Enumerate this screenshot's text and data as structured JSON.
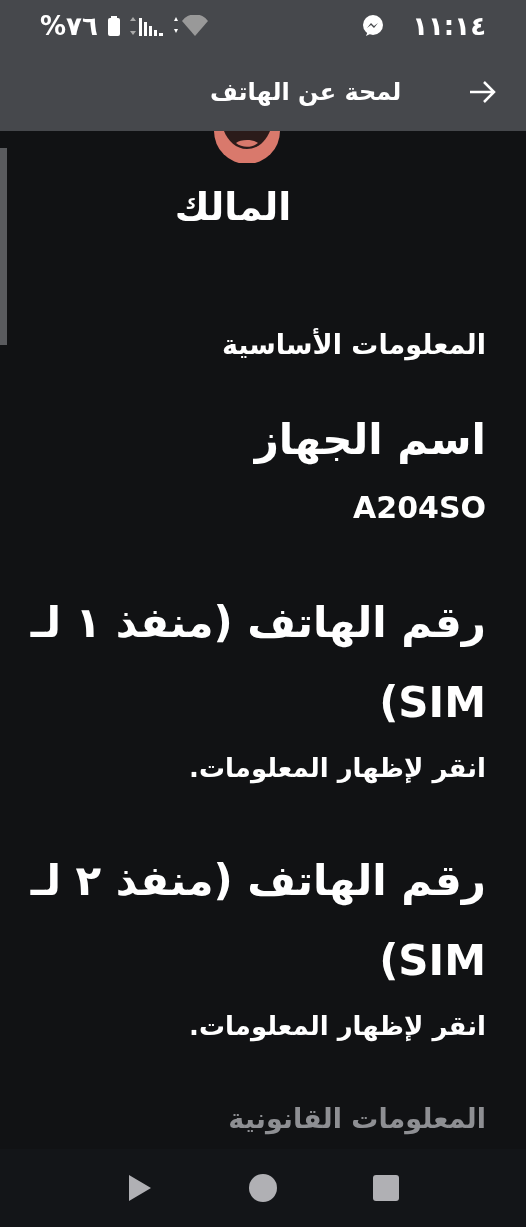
{
  "status_bar": {
    "time": "١١:١٤",
    "battery": "%٧٦"
  },
  "app_bar": {
    "title": "لمحة عن الهاتف"
  },
  "owner": {
    "name": "المالك"
  },
  "items": [
    {
      "kind": "header",
      "text": "المعلومات الأساسية",
      "faded": false
    },
    {
      "kind": "value_item",
      "title": "اسم الجهاز",
      "summary": "A204SO"
    },
    {
      "kind": "tap_item",
      "title": "رقم الهاتف (منفذ ١ لـ SIM)",
      "summary": "انقر لإظهار المعلومات."
    },
    {
      "kind": "tap_item",
      "title": "رقم الهاتف (منفذ ٢ لـ SIM)",
      "summary": "انقر لإظهار المعلومات."
    },
    {
      "kind": "header",
      "text": "المعلومات القانونية",
      "faded": true
    }
  ]
}
